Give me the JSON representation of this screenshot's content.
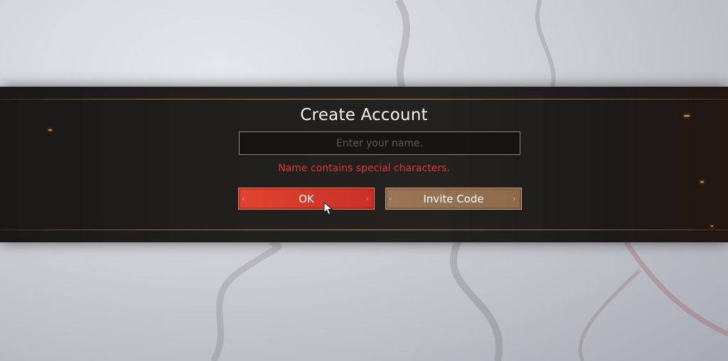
{
  "dialog": {
    "title": "Create Account",
    "name_input": {
      "value": "",
      "placeholder": "Enter your name."
    },
    "error_message": "Name contains special characters.",
    "ok_label": "OK",
    "invite_label": "Invite Code"
  },
  "icons": {
    "cursor": "mouse-cursor-icon",
    "button_ornament": "ornament-icon"
  },
  "colors": {
    "error_text": "#e0352b",
    "ok_button": "#d43a2c",
    "invite_button": "#93704f",
    "band_background": "#21201d",
    "gold_trim": "#b8935a"
  }
}
